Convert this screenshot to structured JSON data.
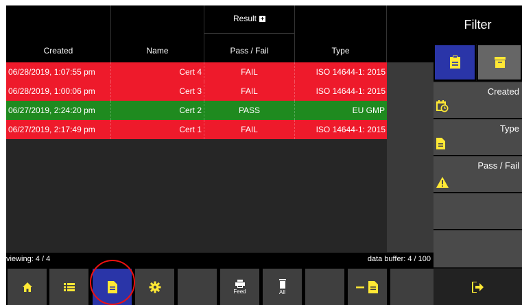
{
  "header": {
    "created": "Created",
    "name": "Name",
    "result_caption": "Result",
    "pass_fail": "Pass / Fail",
    "type": "Type"
  },
  "rows": [
    {
      "created": "06/28/2019, 1:07:55 pm",
      "name": "Cert 4",
      "result": "FAIL",
      "type": "ISO 14644-1: 2015"
    },
    {
      "created": "06/28/2019, 1:00:06 pm",
      "name": "Cert 3",
      "result": "FAIL",
      "type": "ISO 14644-1: 2015"
    },
    {
      "created": "06/27/2019, 2:24:20 pm",
      "name": "Cert 2",
      "result": "PASS",
      "type": "EU GMP"
    },
    {
      "created": "06/27/2019, 2:17:49 pm",
      "name": "Cert 1",
      "result": "FAIL",
      "type": "ISO 14644-1: 2015"
    }
  ],
  "status": {
    "viewing": "viewing: 4 / 4",
    "buffer": "data buffer: 4 / 100"
  },
  "toolbar": {
    "feed_label": "Feed",
    "all_label": "All"
  },
  "filter": {
    "title": "Filter",
    "created": "Created",
    "type": "Type",
    "pass_fail": "Pass / Fail"
  },
  "colors": {
    "fail": "#ee1a2b",
    "pass": "#1f8a1f",
    "accent": "#2a35a8",
    "icon_yellow": "#ffe835"
  },
  "icons": [
    "home-icon",
    "list-icon",
    "document-icon",
    "gear-icon",
    "print-icon",
    "trash-icon",
    "remove-document-icon",
    "clipboard-icon",
    "archive-icon",
    "calendar-clock-icon",
    "warning-icon",
    "exit-icon"
  ]
}
